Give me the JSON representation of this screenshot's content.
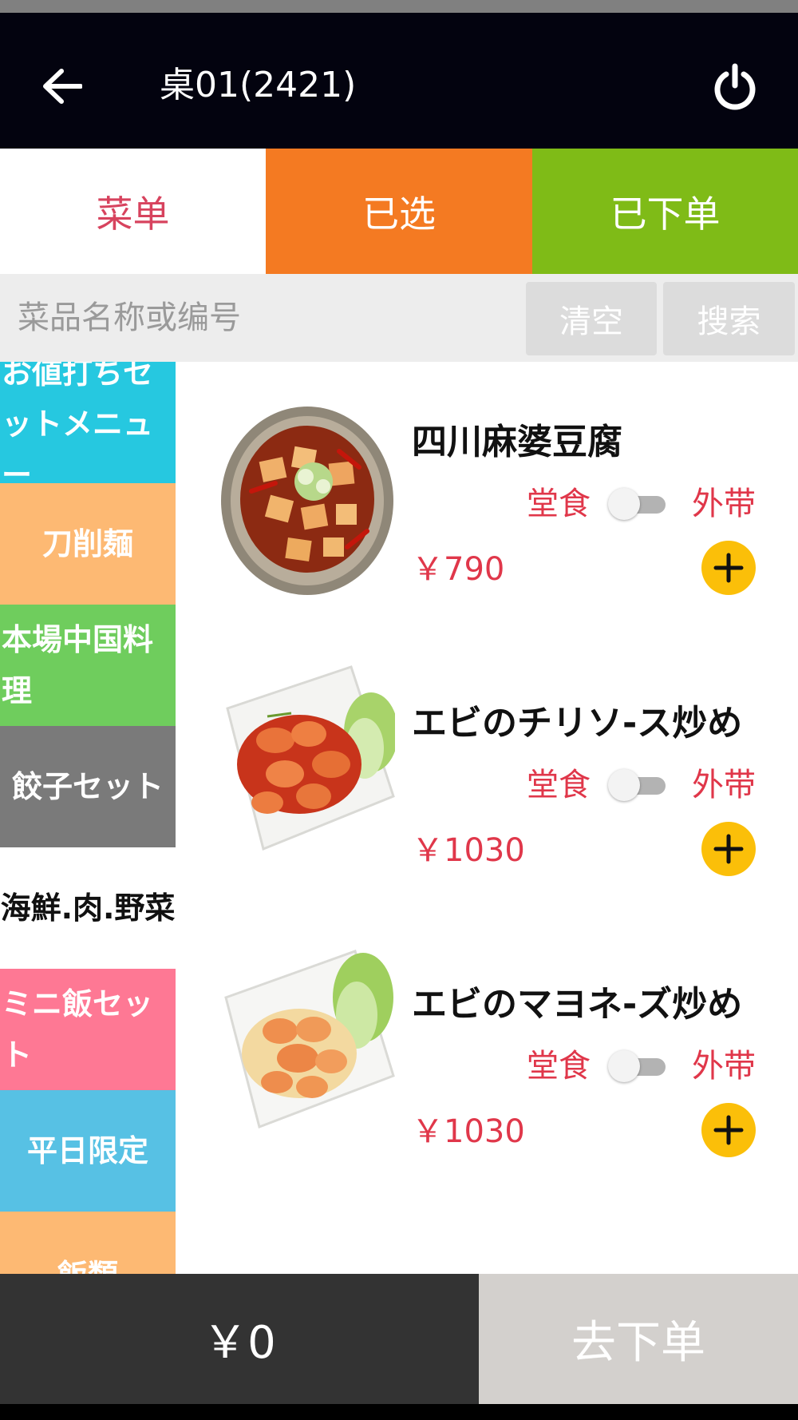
{
  "header": {
    "title": "桌01(2421)",
    "back_icon": "arrow-left-icon",
    "power_icon": "power-icon"
  },
  "tabs": [
    {
      "label": "菜单",
      "active": true,
      "color": "#ffffff"
    },
    {
      "label": "已选",
      "active": false,
      "color": "#f47a22"
    },
    {
      "label": "已下单",
      "active": false,
      "color": "#7fbb17"
    }
  ],
  "search": {
    "placeholder": "菜品名称或编号",
    "value": "",
    "clear_label": "清空",
    "search_label": "搜索"
  },
  "categories": [
    {
      "label": "お値打ちセットメニュー",
      "color": "#26c8e0"
    },
    {
      "label": "刀削麺",
      "color": "#fdb973"
    },
    {
      "label": "本場中国料理",
      "color": "#6fcd5d"
    },
    {
      "label": "餃子セット",
      "color": "#7a7a7a"
    },
    {
      "label": "海鮮.肉.野菜",
      "color": "#ffffff",
      "selected": true
    },
    {
      "label": "ミニ飯セット",
      "color": "#fe7894"
    },
    {
      "label": "平日限定",
      "color": "#57c1e4"
    },
    {
      "label": "飯類",
      "color": "#fdb973"
    }
  ],
  "dishes": [
    {
      "name": "四川麻婆豆腐",
      "dine_in_label": "堂食",
      "takeout_label": "外带",
      "takeout_on": false,
      "price": "￥790"
    },
    {
      "name": "エビのチリソ-ス炒め",
      "dine_in_label": "堂食",
      "takeout_label": "外带",
      "takeout_on": false,
      "price": "￥1030"
    },
    {
      "name": "エビのマヨネ-ズ炒め",
      "dine_in_label": "堂食",
      "takeout_label": "外带",
      "takeout_on": false,
      "price": "￥1030"
    }
  ],
  "footer": {
    "total": "￥0",
    "checkout_label": "去下单"
  },
  "colors": {
    "accent_red": "#e0374a",
    "add_button": "#fbbf09",
    "header_bg": "#03030f"
  }
}
